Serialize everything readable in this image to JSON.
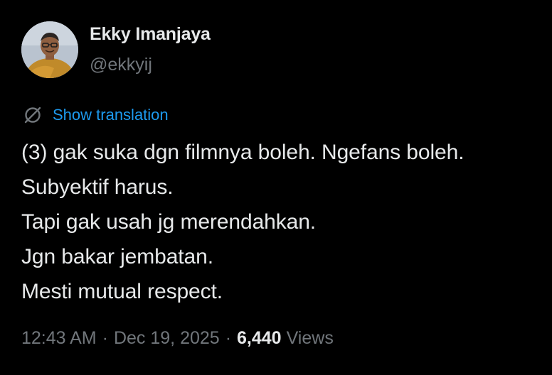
{
  "author": {
    "name": "Ekky Imanjaya",
    "handle": "@ekkyij",
    "avatar_icon": "person-avatar"
  },
  "translation": {
    "icon": "translate-icon",
    "label": "Show translation"
  },
  "tweet": {
    "lines": [
      "(3) gak suka dgn filmnya boleh. Ngefans boleh.",
      "Subyektif harus.",
      "Tapi gak usah jg merendahkan.",
      "Jgn bakar jembatan.",
      "Mesti mutual respect."
    ]
  },
  "meta": {
    "time": "12:43 AM",
    "separator": "·",
    "date": "Dec 19, 2025",
    "views_count": "6,440",
    "views_label": "Views"
  },
  "colors": {
    "background": "#000000",
    "text_primary": "#e7e9ea",
    "text_secondary": "#71767b",
    "accent": "#1d9bf0"
  }
}
